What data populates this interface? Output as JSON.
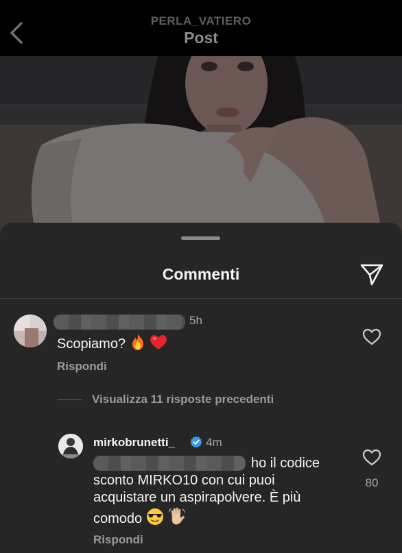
{
  "header": {
    "account": "PERLA_VATIERO",
    "title": "Post"
  },
  "sheet": {
    "title": "Commenti"
  },
  "comment": {
    "time": "5h",
    "text": "Scopiamo?",
    "emojis": [
      "fire-emoji",
      "red-heart-emoji"
    ],
    "reply_label": "Rispondi"
  },
  "replies_toggle": {
    "label": "Visualizza 11 risposte precedenti"
  },
  "reply": {
    "username": "mirkobrunetti_",
    "time": "4m",
    "line1": "ho il codice",
    "line2": "sconto MIRKO10 con cui puoi",
    "line3": "acquistare un aspirapolvere. È più",
    "line4": "comodo",
    "emojis": [
      "sunglasses-emoji",
      "waving-hand-emoji"
    ],
    "likes": "80",
    "reply_label": "Rispondi"
  },
  "colors": {
    "sheet_bg": "#262626",
    "verified_blue": "#3897f0",
    "text_primary": "#f5f5f5",
    "text_secondary": "#a8a8a8"
  }
}
